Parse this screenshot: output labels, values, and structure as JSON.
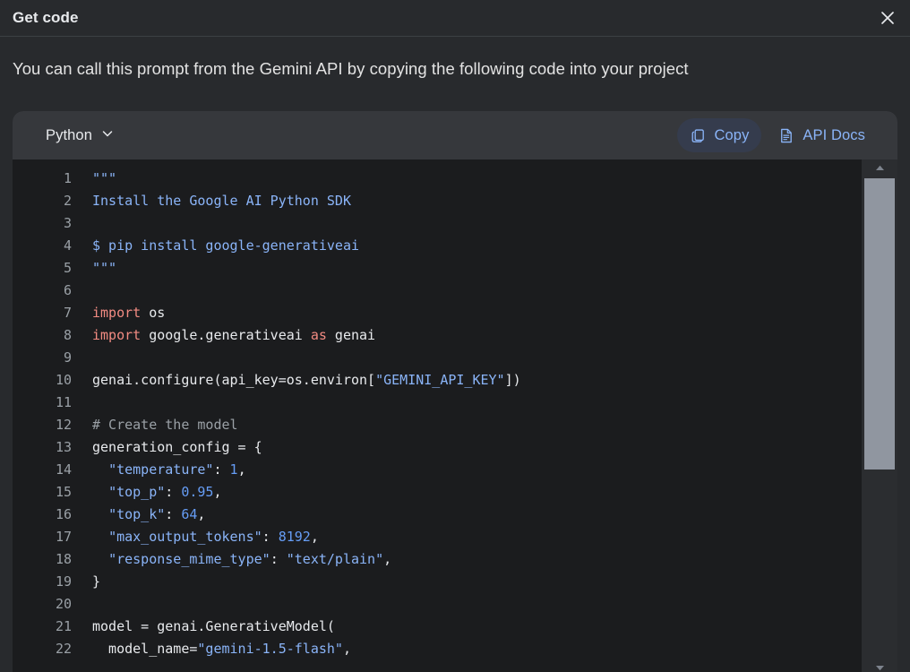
{
  "dialog": {
    "title": "Get code",
    "close_icon": "close-icon",
    "description": "You can call this prompt from the Gemini API by copying the following code into your project"
  },
  "toolbar": {
    "language_label": "Python",
    "language_chevron_icon": "chevron-down-icon",
    "copy_label": "Copy",
    "copy_icon": "copy-icon",
    "api_docs_label": "API Docs",
    "api_docs_icon": "document-icon"
  },
  "colors": {
    "page_background": "#282a2d",
    "toolbar_background": "#36383c",
    "code_background": "#1b1c1e",
    "accent_blue": "#8ab4f8",
    "keyword_red": "#f28b82",
    "number_blue": "#669df6",
    "comment_gray": "#9aa0a6",
    "scrollbar_thumb": "#9096a0",
    "active_button_background": "#353c4d"
  },
  "code": {
    "language": "Python",
    "lines": [
      {
        "n": "1",
        "tokens": [
          {
            "t": "\"\"\"",
            "c": "str"
          }
        ]
      },
      {
        "n": "2",
        "tokens": [
          {
            "t": "Install the Google AI Python SDK",
            "c": "str"
          }
        ]
      },
      {
        "n": "3",
        "tokens": []
      },
      {
        "n": "4",
        "tokens": [
          {
            "t": "$ pip install google-generativeai",
            "c": "str"
          }
        ]
      },
      {
        "n": "5",
        "tokens": [
          {
            "t": "\"\"\"",
            "c": "str"
          }
        ]
      },
      {
        "n": "6",
        "tokens": []
      },
      {
        "n": "7",
        "tokens": [
          {
            "t": "import",
            "c": "kw"
          },
          {
            "t": " os",
            "c": "def"
          }
        ]
      },
      {
        "n": "8",
        "tokens": [
          {
            "t": "import",
            "c": "kw"
          },
          {
            "t": " google.generativeai ",
            "c": "def"
          },
          {
            "t": "as",
            "c": "kw"
          },
          {
            "t": " genai",
            "c": "def"
          }
        ]
      },
      {
        "n": "9",
        "tokens": []
      },
      {
        "n": "10",
        "tokens": [
          {
            "t": "genai.configure(api_key=os.environ[",
            "c": "def"
          },
          {
            "t": "\"GEMINI_API_KEY\"",
            "c": "str"
          },
          {
            "t": "])",
            "c": "def"
          }
        ]
      },
      {
        "n": "11",
        "tokens": []
      },
      {
        "n": "12",
        "tokens": [
          {
            "t": "# Create the model",
            "c": "com"
          }
        ]
      },
      {
        "n": "13",
        "tokens": [
          {
            "t": "generation_config = {",
            "c": "def"
          }
        ]
      },
      {
        "n": "14",
        "tokens": [
          {
            "t": "  ",
            "c": "def"
          },
          {
            "t": "\"temperature\"",
            "c": "str"
          },
          {
            "t": ": ",
            "c": "def"
          },
          {
            "t": "1",
            "c": "num"
          },
          {
            "t": ",",
            "c": "def"
          }
        ]
      },
      {
        "n": "15",
        "tokens": [
          {
            "t": "  ",
            "c": "def"
          },
          {
            "t": "\"top_p\"",
            "c": "str"
          },
          {
            "t": ": ",
            "c": "def"
          },
          {
            "t": "0.95",
            "c": "num"
          },
          {
            "t": ",",
            "c": "def"
          }
        ]
      },
      {
        "n": "16",
        "tokens": [
          {
            "t": "  ",
            "c": "def"
          },
          {
            "t": "\"top_k\"",
            "c": "str"
          },
          {
            "t": ": ",
            "c": "def"
          },
          {
            "t": "64",
            "c": "num"
          },
          {
            "t": ",",
            "c": "def"
          }
        ]
      },
      {
        "n": "17",
        "tokens": [
          {
            "t": "  ",
            "c": "def"
          },
          {
            "t": "\"max_output_tokens\"",
            "c": "str"
          },
          {
            "t": ": ",
            "c": "def"
          },
          {
            "t": "8192",
            "c": "num"
          },
          {
            "t": ",",
            "c": "def"
          }
        ]
      },
      {
        "n": "18",
        "tokens": [
          {
            "t": "  ",
            "c": "def"
          },
          {
            "t": "\"response_mime_type\"",
            "c": "str"
          },
          {
            "t": ": ",
            "c": "def"
          },
          {
            "t": "\"text/plain\"",
            "c": "str"
          },
          {
            "t": ",",
            "c": "def"
          }
        ]
      },
      {
        "n": "19",
        "tokens": [
          {
            "t": "}",
            "c": "def"
          }
        ]
      },
      {
        "n": "20",
        "tokens": []
      },
      {
        "n": "21",
        "tokens": [
          {
            "t": "model = genai.GenerativeModel(",
            "c": "def"
          }
        ]
      },
      {
        "n": "22",
        "tokens": [
          {
            "t": "  model_name=",
            "c": "def"
          },
          {
            "t": "\"gemini-1.5-flash\"",
            "c": "str"
          },
          {
            "t": ",",
            "c": "def"
          }
        ]
      }
    ]
  },
  "scrollbar": {
    "up_arrow_icon": "triangle-up-icon",
    "down_arrow_icon": "triangle-down-icon"
  }
}
